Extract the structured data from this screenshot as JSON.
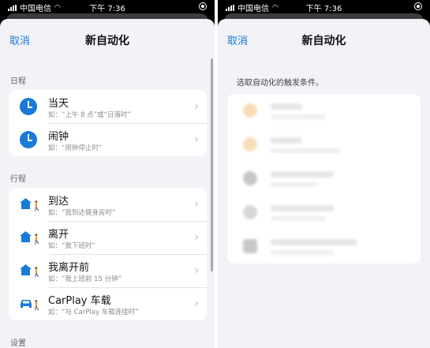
{
  "status_bar": {
    "carrier": "中国电信",
    "time": "下午 7:36"
  },
  "nav": {
    "cancel": "取消",
    "title": "新自动化"
  },
  "sections": [
    {
      "header": "日程",
      "items": [
        {
          "title": "当天",
          "subtitle": "如：“上午 8 点”或“日落时”",
          "icon": "clock-icon"
        },
        {
          "title": "闹钟",
          "subtitle": "如：“闹钟停止时”",
          "icon": "clock-icon"
        }
      ]
    },
    {
      "header": "行程",
      "items": [
        {
          "title": "到达",
          "subtitle": "如：“我到达健身房时”",
          "icon": "house-walker-icon"
        },
        {
          "title": "离开",
          "subtitle": "如：“我下班时”",
          "icon": "house-walker-icon"
        },
        {
          "title": "我离开前",
          "subtitle": "如：“我上班前 15 分钟”",
          "icon": "house-walker-icon"
        },
        {
          "title": "CarPlay 车载",
          "subtitle": "如：“与 CarPlay 车载连接时”",
          "icon": "car-walker-icon"
        }
      ]
    },
    {
      "header": "设置"
    }
  ],
  "right_panel": {
    "hint": "选取自动化的触发条件。"
  },
  "colors": {
    "accent": "#1a7ad8",
    "background": "#f2f2f7"
  }
}
